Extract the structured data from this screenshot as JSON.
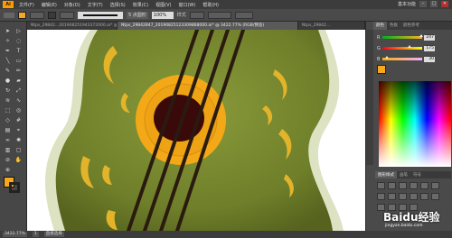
{
  "app": {
    "logo": "Ai",
    "workspace": "基本功能"
  },
  "menu": [
    "文件(F)",
    "编辑(E)",
    "对象(O)",
    "文字(T)",
    "选择(S)",
    "效果(C)",
    "视图(V)",
    "窗口(W)",
    "帮助(H)"
  ],
  "control": {
    "fill_color": "#f7a81e",
    "stroke_color": "#3a3a3a",
    "stroke_label": "5 点圆形",
    "opacity": "100%",
    "style_label": "样式"
  },
  "tabs": [
    {
      "label": "Ntps_29842...201908251943372000.ai* @...",
      "active": false
    },
    {
      "label": "Ntps_29842847_20190825123309868000.ai* @ 3422.77% (RGB/预览)",
      "active": true
    },
    {
      "label": "Ntps_29842...",
      "active": false
    }
  ],
  "tools": [
    "selection-arrow",
    "direct-select",
    "magic-wand",
    "lasso",
    "pen",
    "type",
    "line",
    "rectangle",
    "paintbrush",
    "pencil",
    "blob-brush",
    "eraser",
    "rotate",
    "scale",
    "width",
    "warp",
    "free-transform",
    "shape-builder",
    "perspective",
    "mesh",
    "gradient",
    "eyedropper",
    "blend",
    "symbol-sprayer",
    "column-graph",
    "artboard",
    "slice",
    "hand",
    "zoom"
  ],
  "color_panel": {
    "tabs": [
      "颜色",
      "色板",
      "颜色参考"
    ],
    "channels": [
      {
        "name": "R",
        "value": "247",
        "pct": 0.97
      },
      {
        "name": "G",
        "value": "175",
        "pct": 0.68
      },
      {
        "name": "B",
        "value": "30",
        "pct": 0.12
      }
    ]
  },
  "panel2": {
    "tabs": [
      "图形样式",
      "画笔",
      "符号"
    ]
  },
  "status": {
    "zoom": "3422.77%",
    "page": "1",
    "mode": "直接选择"
  },
  "watermark": {
    "title": "Baidu经验",
    "sub": "jingyan.baidu.com"
  }
}
